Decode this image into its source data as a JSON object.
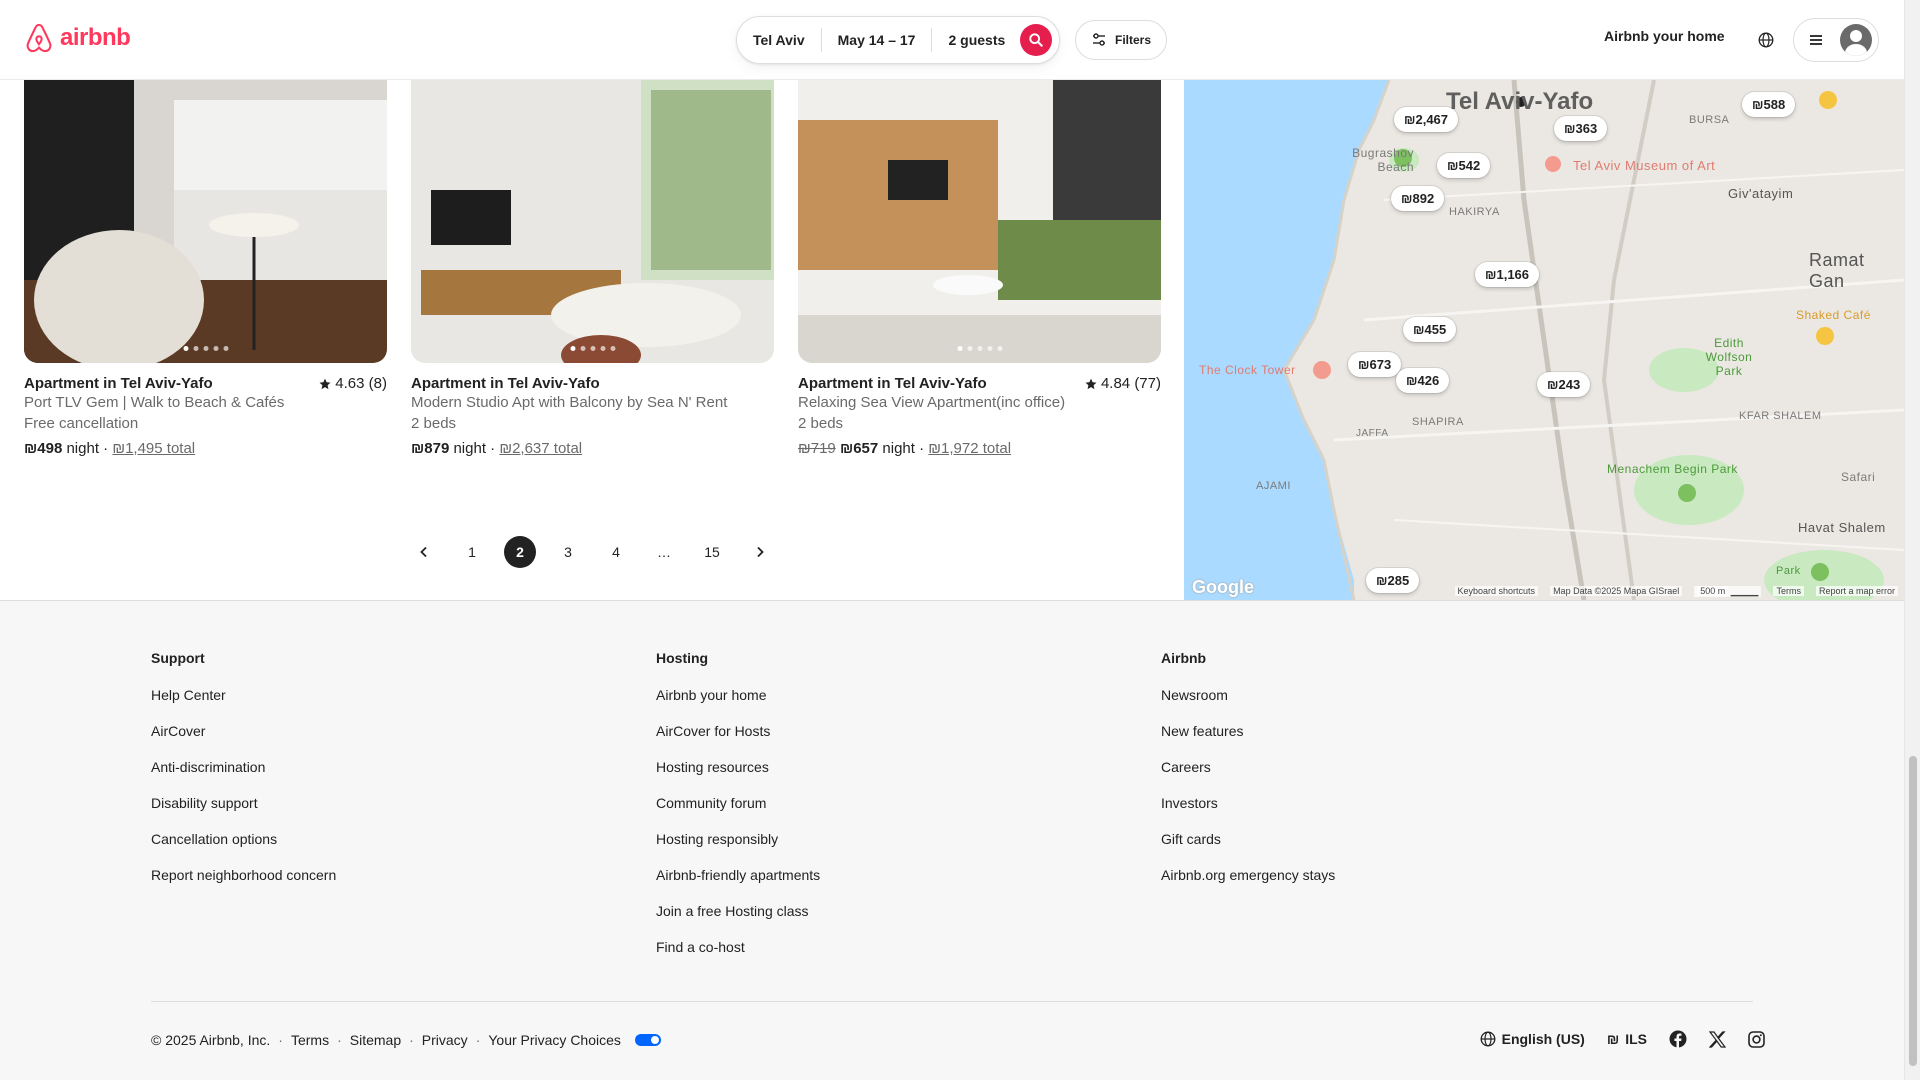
{
  "header": {
    "brand": "airbnb",
    "search": {
      "location": "Tel Aviv",
      "dates": "May 14 – 17",
      "guests": "2 guests"
    },
    "filters_label": "Filters",
    "host_link": "Airbnb your home"
  },
  "listings": [
    {
      "title": "Apartment in Tel Aviv-Yafo",
      "rating": "4.63 (8)",
      "subtitle": "Port TLV Gem | Walk to Beach & Cafés",
      "detail": "Free cancellation",
      "old_price": "",
      "price": "₪498",
      "price_unit": "night",
      "total": "₪1,495 total"
    },
    {
      "title": "Apartment in Tel Aviv-Yafo",
      "rating": "",
      "subtitle": "Modern Studio Apt with Balcony by Sea N' Rent",
      "detail": "2 beds",
      "old_price": "",
      "price": "₪879",
      "price_unit": "night",
      "total": "₪2,637 total"
    },
    {
      "title": "Apartment in Tel Aviv-Yafo",
      "rating": "4.84 (77)",
      "subtitle": "Relaxing Sea View Apartment(inc office)",
      "detail": "2 beds",
      "old_price": "₪719",
      "price": "₪657",
      "price_unit": "night",
      "total": "₪1,972 total"
    }
  ],
  "pagination": {
    "pages": [
      "1",
      "2",
      "3",
      "4",
      "…",
      "15"
    ],
    "current": "2"
  },
  "map": {
    "city": "Tel Aviv-Yafo",
    "labels": [
      "Bugrashov Beach",
      "Tel Aviv Museum of Art",
      "Giv'atayim",
      "HAKIRYA",
      "Ramat Gan",
      "Shaked Café",
      "Edith Wolfson Park",
      "The Clock Tower",
      "JAFFA",
      "SHAPIRA",
      "KFAR SHALEM",
      "Menachem Begin Park",
      "AJAMI",
      "Safari",
      "Havat Shalem",
      "Park",
      "BURSA"
    ],
    "pins": [
      "₪2,467",
      "₪363",
      "₪588",
      "₪542",
      "₪892",
      "₪1,166",
      "₪455",
      "₪673",
      "₪426",
      "₪243",
      "₪285"
    ],
    "footer": {
      "google": "Google",
      "shortcuts": "Keyboard shortcuts",
      "data": "Map Data ©2025 Mapa GISrael",
      "scale": "500 m",
      "terms": "Terms",
      "report": "Report a map error"
    }
  },
  "footer": {
    "columns": [
      {
        "heading": "Support",
        "links": [
          "Help Center",
          "AirCover",
          "Anti-discrimination",
          "Disability support",
          "Cancellation options",
          "Report neighborhood concern"
        ]
      },
      {
        "heading": "Hosting",
        "links": [
          "Airbnb your home",
          "AirCover for Hosts",
          "Hosting resources",
          "Community forum",
          "Hosting responsibly",
          "Airbnb-friendly apartments",
          "Join a free Hosting class",
          "Find a co-host"
        ]
      },
      {
        "heading": "Airbnb",
        "links": [
          "Newsroom",
          "New features",
          "Careers",
          "Investors",
          "Gift cards",
          "Airbnb.org emergency stays"
        ]
      }
    ],
    "copyright": "© 2025 Airbnb, Inc.",
    "legal_links": [
      "Terms",
      "Sitemap",
      "Privacy",
      "Your Privacy Choices"
    ],
    "language": "English (US)",
    "currency_symbol": "₪",
    "currency": "ILS"
  },
  "colors": {
    "brand": "#ff385c",
    "search_button": "#e61e4d",
    "text": "#222222",
    "muted": "#6a6a6a"
  },
  "icons": [
    "airbnb-logo-icon",
    "search-icon",
    "filters-icon",
    "globe-icon",
    "menu-icon",
    "star-icon",
    "chevron-left-icon",
    "chevron-right-icon",
    "facebook-icon",
    "x-icon",
    "instagram-icon"
  ]
}
